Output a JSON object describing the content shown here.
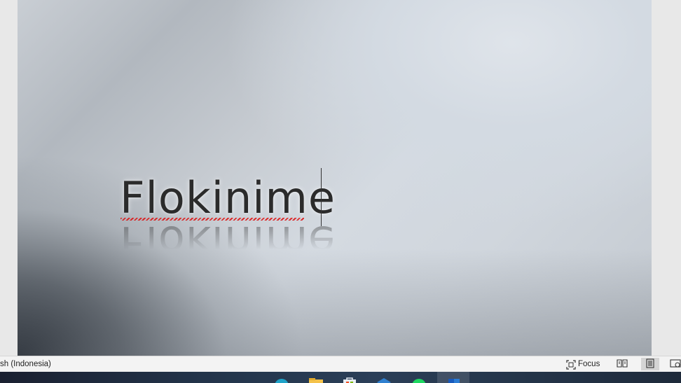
{
  "document": {
    "wordart_text": "Flokinime"
  },
  "statusbar": {
    "language": "sh (Indonesia)",
    "focus_label": "Focus",
    "icons": [
      "focus-icon",
      "read-mode-icon",
      "print-layout-icon",
      "web-layout-icon"
    ]
  },
  "taskbar": {
    "icons": [
      "edge-icon",
      "file-explorer-icon",
      "store-icon",
      "vscode-icon",
      "spotify-icon",
      "word-icon"
    ]
  },
  "colors": {
    "wordart_text": "#2b2b2b",
    "spellcheck_underline": "#dd1111",
    "statusbar_bg": "#f3f3f3"
  }
}
